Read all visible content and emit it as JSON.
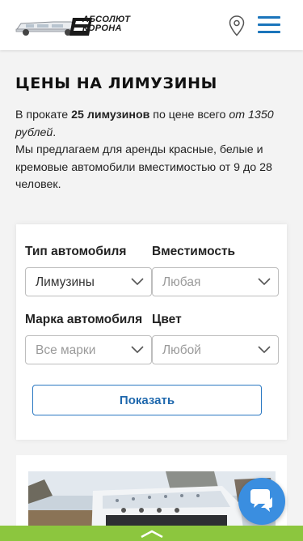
{
  "header": {
    "logo_line1": "АБСОЛЮТ",
    "logo_line2": "КОРОНА",
    "location_icon": "map-pin-icon",
    "menu_icon": "hamburger-icon",
    "accent_color": "#1b75bb"
  },
  "page": {
    "title": "ЦЕНЫ НА ЛИМУЗИНЫ",
    "intro_a": "В прокате ",
    "intro_count": "25 лимузинов",
    "intro_b": " по цене всего ",
    "intro_price": "от 1350 рублей",
    "intro_c": ".",
    "intro_line2": "Мы предлагаем для аренды красные, белые и кремовые автомобили вместимостью от 9 до 28 человек."
  },
  "filter": {
    "type_label": "Тип автомобиля",
    "type_value": "Лимузины",
    "capacity_label": "Вместимость",
    "capacity_value": "Любая",
    "brand_label": "Марка автомобиля",
    "brand_value": "Все марки",
    "color_label": "Цвет",
    "color_value": "Любой",
    "submit_label": "Показать"
  },
  "widgets": {
    "chat_icon": "chat-bubble-icon",
    "scroll_icon": "chevron-up-icon",
    "chat_color": "#3a8ee0",
    "bar_color": "#8cc63e"
  }
}
